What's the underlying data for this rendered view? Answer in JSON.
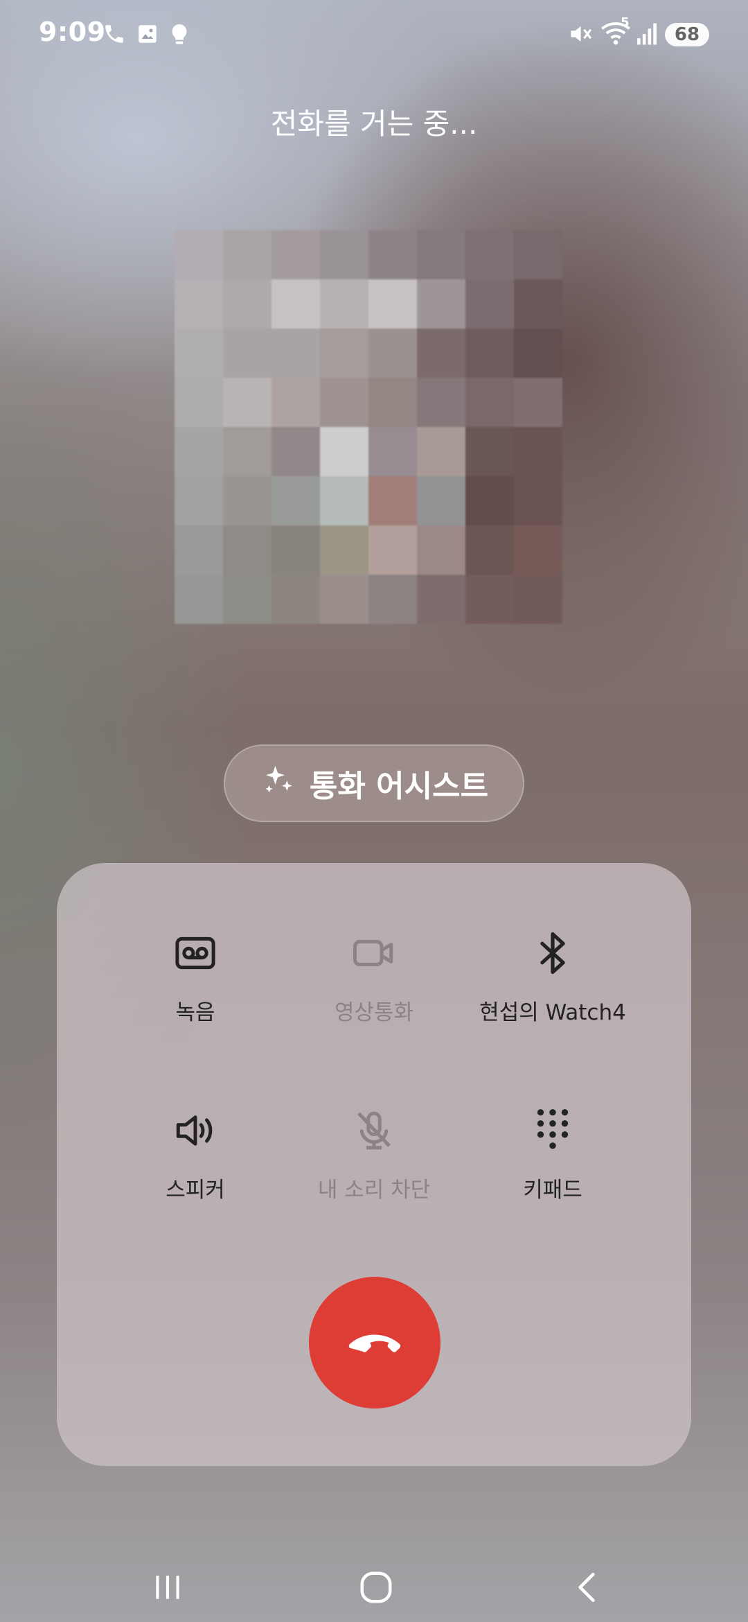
{
  "status_bar": {
    "time": "9:09",
    "battery": "68",
    "left_icons": [
      "phone-icon",
      "image-icon",
      "bulb-icon"
    ],
    "right_icons": [
      "mute-icon",
      "wifi-icon",
      "signal-icon",
      "battery-icon"
    ],
    "wifi_badge": "5"
  },
  "call": {
    "status": "전화를 거는 중..."
  },
  "assist": {
    "label": "통화 어시스트",
    "icon": "sparkle-icon"
  },
  "controls": [
    {
      "label": "녹음",
      "icon": "voicemail-icon",
      "enabled": true
    },
    {
      "label": "영상통화",
      "icon": "video-icon",
      "enabled": false
    },
    {
      "label": "현섭의 Watch4",
      "icon": "bluetooth-icon",
      "enabled": true
    },
    {
      "label": "스피커",
      "icon": "speaker-icon",
      "enabled": true
    },
    {
      "label": "내 소리 차단",
      "icon": "mic-off-icon",
      "enabled": false
    },
    {
      "label": "키패드",
      "icon": "keypad-icon",
      "enabled": true
    }
  ],
  "end_call": {
    "icon": "end-call-icon",
    "color": "#de3d36"
  },
  "nav": [
    "recents-icon",
    "home-icon",
    "back-icon"
  ]
}
